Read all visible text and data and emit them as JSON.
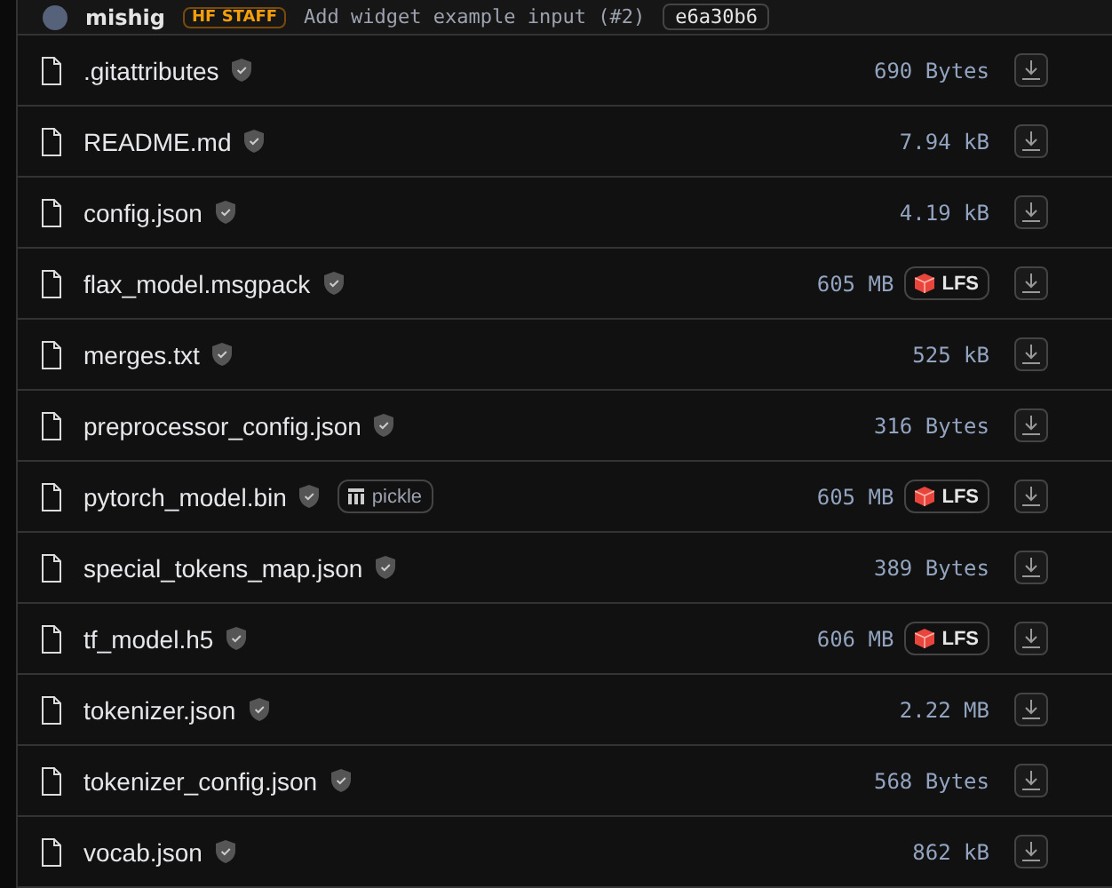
{
  "commit": {
    "author": "mishig",
    "badge": "HF STAFF",
    "message": "Add widget example input (#2)",
    "hash": "e6a30b6"
  },
  "files": [
    {
      "name": ".gitattributes",
      "size": "690 Bytes"
    },
    {
      "name": "README.md",
      "size": "7.94 kB"
    },
    {
      "name": "config.json",
      "size": "4.19 kB"
    },
    {
      "name": "flax_model.msgpack",
      "size": "605 MB",
      "lfs_label": "LFS"
    },
    {
      "name": "merges.txt",
      "size": "525 kB"
    },
    {
      "name": "preprocessor_config.json",
      "size": "316 Bytes"
    },
    {
      "name": "pytorch_model.bin",
      "tag": "pickle",
      "size": "605 MB",
      "lfs_label": "LFS"
    },
    {
      "name": "special_tokens_map.json",
      "size": "389 Bytes"
    },
    {
      "name": "tf_model.h5",
      "size": "606 MB",
      "lfs_label": "LFS"
    },
    {
      "name": "tokenizer.json",
      "size": "2.22 MB"
    },
    {
      "name": "tokenizer_config.json",
      "size": "568 Bytes"
    },
    {
      "name": "vocab.json",
      "size": "862 kB"
    }
  ]
}
